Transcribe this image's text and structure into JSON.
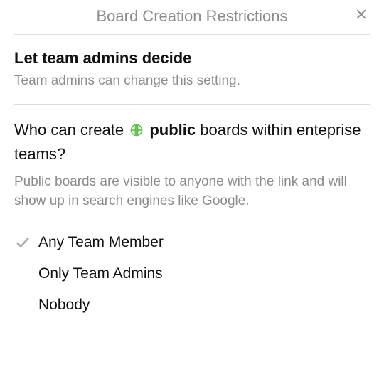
{
  "header": {
    "title": "Board Creation Restrictions",
    "close_icon": "close"
  },
  "admin_section": {
    "heading": "Let team admins decide",
    "subtext": "Team admins can change this setting."
  },
  "question": {
    "prefix": "Who can create",
    "visibility_icon": "globe",
    "visibility_label": "public",
    "suffix": "boards within enteprise teams?"
  },
  "explain": "Public boards are visible to anyone with the link and will show up in search engines like Google.",
  "options": [
    {
      "label": "Any Team Member",
      "selected": true
    },
    {
      "label": "Only Team Admins",
      "selected": false
    },
    {
      "label": "Nobody",
      "selected": false
    }
  ]
}
